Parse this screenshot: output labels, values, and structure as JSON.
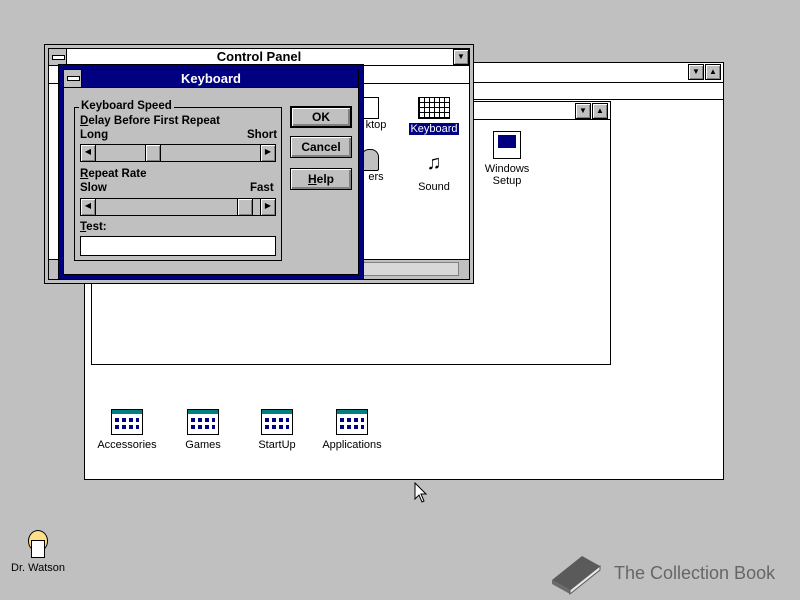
{
  "program_manager": {
    "groups": [
      {
        "label": "Accessories"
      },
      {
        "label": "Games"
      },
      {
        "label": "StartUp"
      },
      {
        "label": "Applications"
      }
    ]
  },
  "control_panel": {
    "title": "Control Panel",
    "icons": {
      "desktop_label": "ktop",
      "printers_label": "ers",
      "keyboard_label": "Keyboard",
      "sound_label": "Sound",
      "windows_setup_label_1": "Windows",
      "windows_setup_label_2": "Setup"
    }
  },
  "keyboard_dialog": {
    "title": "Keyboard",
    "group_title": "Keyboard Speed",
    "delay_label": "Delay Before First Repeat",
    "delay_min": "Long",
    "delay_max": "Short",
    "delay_value": 0.33,
    "rate_label": "Repeat Rate",
    "rate_min": "Slow",
    "rate_max": "Fast",
    "rate_value": 0.96,
    "test_label": "Test:",
    "test_value": "",
    "ok_label": "OK",
    "cancel_label": "Cancel",
    "help_label": "Help"
  },
  "desktop": {
    "dr_watson_label": "Dr. Watson",
    "watermark": "The Collection Book"
  },
  "colors": {
    "active_title": "#000080",
    "window_face": "#c0c0c0",
    "selection": "#000080"
  }
}
